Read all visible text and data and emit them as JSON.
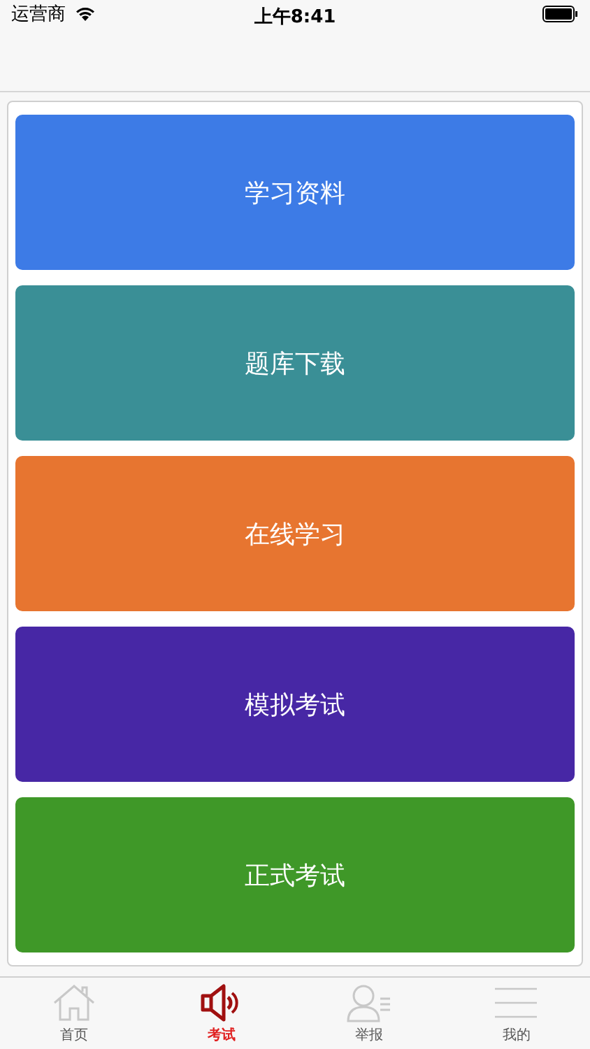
{
  "status_bar": {
    "carrier": "运营商",
    "time": "上午8:41"
  },
  "menu": [
    {
      "label": "学习资料",
      "color": "#3d7be6"
    },
    {
      "label": "题库下载",
      "color": "#3a8f96"
    },
    {
      "label": "在线学习",
      "color": "#e77530"
    },
    {
      "label": "模拟考试",
      "color": "#4727a5"
    },
    {
      "label": "正式考试",
      "color": "#3f9828"
    }
  ],
  "tabs": [
    {
      "label": "首页",
      "kind": "home",
      "selected": false
    },
    {
      "label": "考试",
      "kind": "speaker",
      "selected": true
    },
    {
      "label": "举报",
      "kind": "person",
      "selected": false
    },
    {
      "label": "我的",
      "kind": "lines",
      "selected": false
    }
  ]
}
